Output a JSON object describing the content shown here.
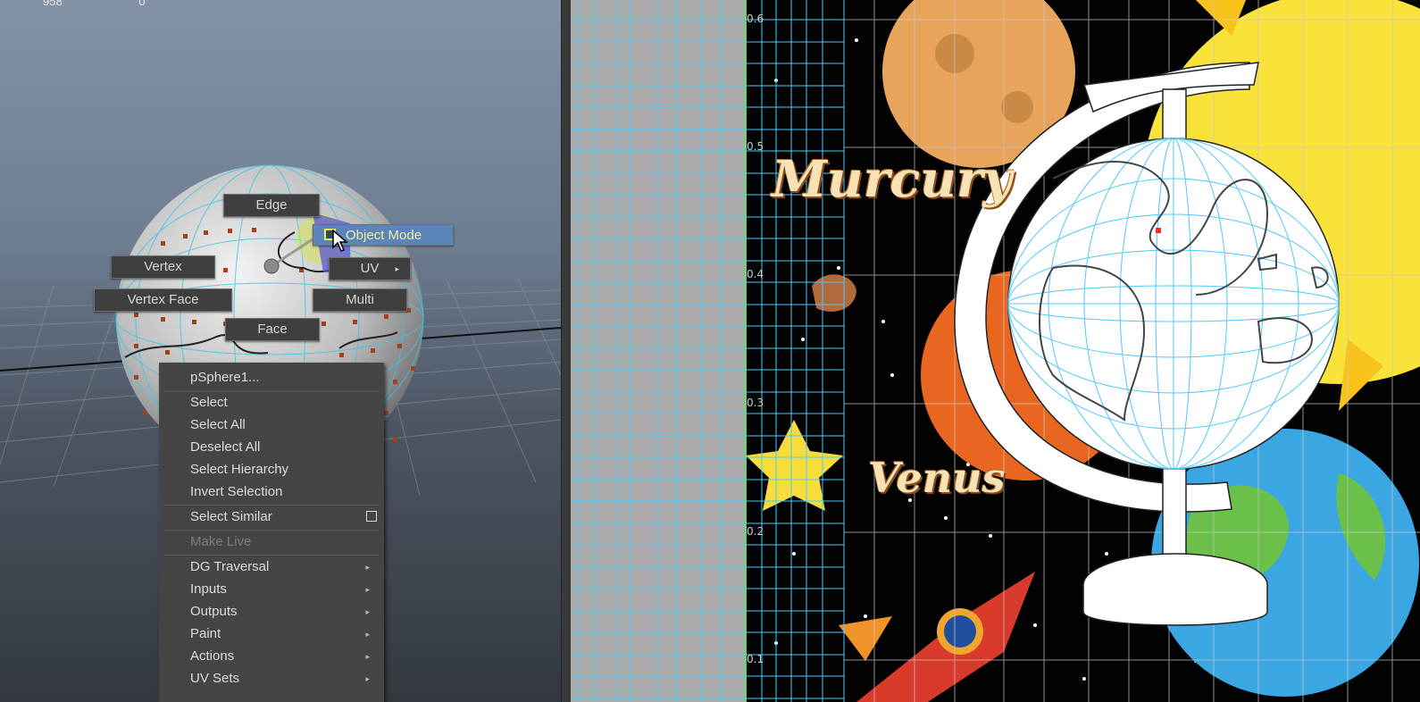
{
  "hud": {
    "left_value": "958",
    "right_value": "0"
  },
  "marking_menu": {
    "edge": "Edge",
    "object_mode": "Object Mode",
    "vertex": "Vertex",
    "uv": "UV",
    "vertex_face": "Vertex Face",
    "multi": "Multi",
    "face": "Face"
  },
  "context_menu": {
    "title": "pSphere1...",
    "items": [
      {
        "label": "Select"
      },
      {
        "label": "Select All"
      },
      {
        "label": "Deselect All"
      },
      {
        "label": "Select Hierarchy"
      },
      {
        "label": "Invert Selection"
      },
      {
        "label": "Select Similar"
      },
      {
        "label": "Make Live"
      },
      {
        "label": "DG Traversal"
      },
      {
        "label": "Inputs"
      },
      {
        "label": "Outputs"
      },
      {
        "label": "Paint"
      },
      {
        "label": "Actions"
      },
      {
        "label": "UV Sets"
      }
    ]
  },
  "uv_editor": {
    "ticks": [
      "0.6",
      "0.5",
      "0.4",
      "0.3",
      "0.2",
      "0.1"
    ],
    "labels": {
      "mercury": "Murcury",
      "venus": "Venus"
    }
  },
  "icons": {
    "object_mode_icon": "object-mode-icon",
    "cursor": "arrow-cursor-icon",
    "submenu": "chevron-right-icon",
    "option_box": "option-box-icon"
  },
  "colors": {
    "uv_grid": "#4fc8ff",
    "menu_bg": "#454545",
    "active_item": "#5b85b8",
    "space_bg": "#000000"
  }
}
